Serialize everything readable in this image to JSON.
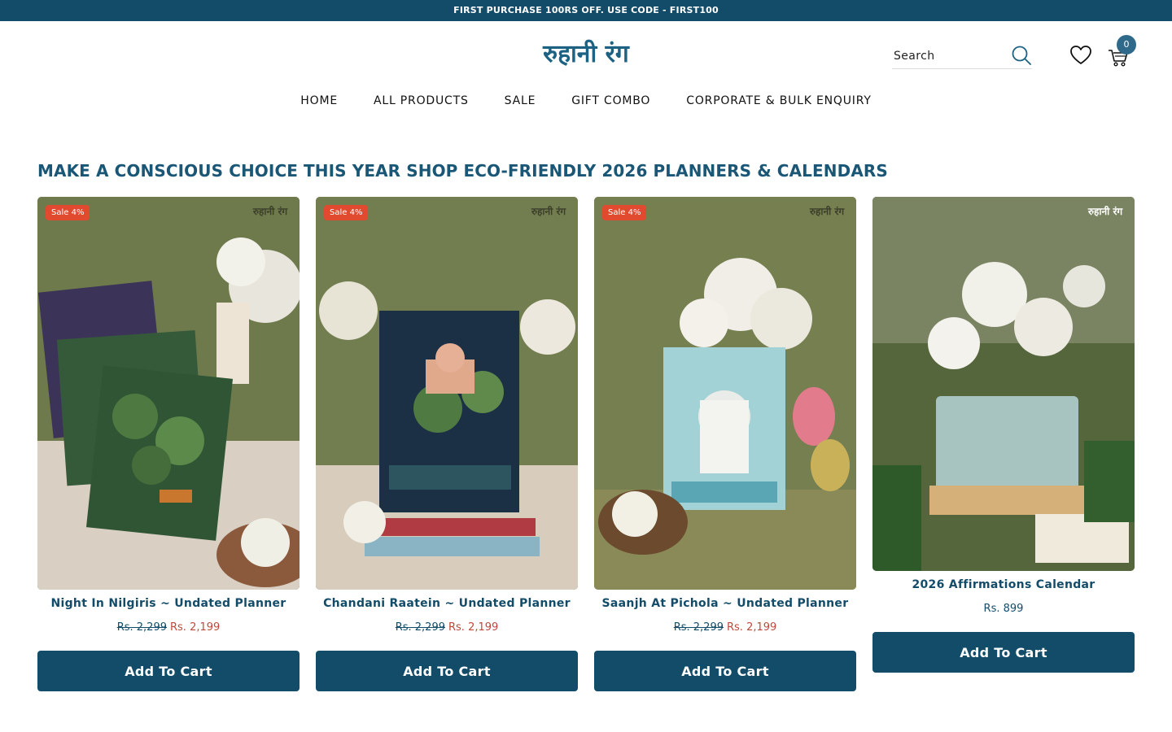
{
  "announcement": "FIRST PURCHASE 100RS OFF. USE CODE - FIRST100",
  "brand": {
    "logo_text": "रुहानी रंग"
  },
  "search": {
    "placeholder": "Search"
  },
  "cart": {
    "count": "0"
  },
  "nav": [
    "HOME",
    "ALL PRODUCTS",
    "SALE",
    "GIFT COMBO",
    "CORPORATE & BULK ENQUIRY"
  ],
  "section_heading": "MAKE A CONSCIOUS CHOICE THIS YEAR SHOP ECO-FRIENDLY 2026 PLANNERS & CALENDARS",
  "products": [
    {
      "title": "Night In Nilgiris ~ Undated Planner",
      "badge": "Sale 4%",
      "price_old": "Rs. 2,299",
      "price_new": "Rs. 2,199",
      "button": "Add To Cart"
    },
    {
      "title": "Chandani Raatein ~ Undated Planner",
      "badge": "Sale 4%",
      "price_old": "Rs. 2,299",
      "price_new": "Rs. 2,199",
      "button": "Add To Cart"
    },
    {
      "title": "Saanjh At Pichola ~ Undated Planner",
      "badge": "Sale 4%",
      "price_old": "Rs. 2,299",
      "price_new": "Rs. 2,199",
      "button": "Add To Cart"
    },
    {
      "title": "2026 Affirmations Calendar",
      "price": "Rs. 899",
      "button": "Add To Cart"
    }
  ],
  "colors": {
    "primary": "#134c69",
    "sale_badge": "#e14a2f",
    "sale_price": "#c0473a"
  },
  "icons": [
    "search-icon",
    "heart-icon",
    "cart-icon"
  ]
}
